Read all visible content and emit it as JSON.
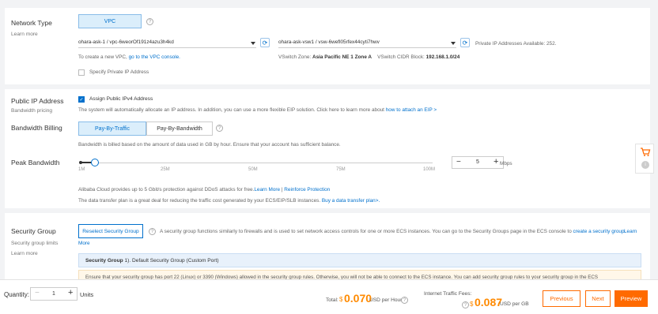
{
  "network": {
    "title": "Network Type",
    "learn_more": "Learn more",
    "vpc_button": "VPC",
    "vpc_select": "ohara-ask-1 / vpc-6weorOf191z4azu3h4kd",
    "vswitch_select": "ohara-ask-vsw1 / vsw-6wefl05rfex44cyti7hwv",
    "ip_available": "Private IP Addresses Available: 252.",
    "create_vpc_prefix": "To create a new VPC,",
    "create_vpc_link": "go to the VPC console.",
    "vswitch_zone_label": "VSwitch Zone:",
    "vswitch_zone_value": "Asia Pacific NE 1 Zone A",
    "cidr_label": "VSwitch CIDR Block:",
    "cidr_value": "192.168.1.0/24",
    "specify_ip_label": "Specify Private IP Address"
  },
  "public_ip": {
    "title": "Public IP Address",
    "bandwidth_pricing": "Bandwidth pricing",
    "assign_label": "Assign Public IPv4 Address",
    "assign_desc": "The system will automatically allocate an IP address. In addition, you can use a more flexible EIP solution. Click here to learn more about",
    "assign_link": "how to attach an EIP >",
    "billing_title": "Bandwidth Billing",
    "pay_traffic": "Pay-By-Traffic",
    "pay_bandwidth": "Pay-By-Bandwidth",
    "billing_desc": "Bandwidth is billed based on the amount of data used in GB by hour. Ensure that your account has sufficient balance.",
    "peak_title": "Peak Bandwidth",
    "slider_ticks": [
      "1M",
      "25M",
      "50M",
      "75M",
      "100M"
    ],
    "slider_value": 5,
    "slider_max": 100,
    "stepper_value": "5",
    "stepper_minus": "−",
    "stepper_plus": "+",
    "stepper_unit": "Mbps",
    "ddos_text": "Alibaba Cloud provides up to 5 Gbit/s protection against DDoS attacks for free.",
    "ddos_learn": "Learn More",
    "ddos_sep": "|",
    "ddos_reinforce": "Reinforce Protection",
    "transfer_text": "The data transfer plan is a great deal for reducing the traffic cost generated by your ECS/EIP/SLB instances.",
    "transfer_link": "Buy a data transfer plan>."
  },
  "security": {
    "title": "Security Group",
    "limits": "Security group limits",
    "learn_more": "Learn more",
    "reselect_button": "Reselect Security Group",
    "desc": "A security group functions similarly to firewalls and is used to set network access controls for one or more ECS instances. You can go to the Security Groups page in the ECS console to",
    "create_link": "create a security group.",
    "learn_link_1": "Learn",
    "learn_link_2": "More",
    "group_label": "Security Group",
    "group_value": "1). Default Security Group (Custom Port)",
    "port_warning": "Ensure that your security group has port 22 (Linux) or 3390 (Windows) allowed in the security group rules. Otherwise, you will not be able to connect to the ECS instance. You can add security group rules to your security group in the ECS"
  },
  "footer": {
    "quantity_label": "Quantity:",
    "quantity_minus": "−",
    "quantity_value": "1",
    "quantity_plus": "+",
    "units_label": "Units",
    "total_label": "Total:",
    "total_currency": "$",
    "total_price": "0.070",
    "total_unit": "USD per Hour",
    "traffic_label": "Internet Traffic Fees:",
    "traffic_currency": "$",
    "traffic_price": "0.087",
    "traffic_unit": "USD per GB",
    "previous": "Previous",
    "next": "Next",
    "preview": "Preview"
  },
  "colors": {
    "accent": "#0070cc",
    "orange": "#ff6a00",
    "price": "#ff8a00"
  },
  "icons": {
    "cart": "cart-icon",
    "help": "question-circle-icon",
    "refresh": "refresh-icon"
  }
}
